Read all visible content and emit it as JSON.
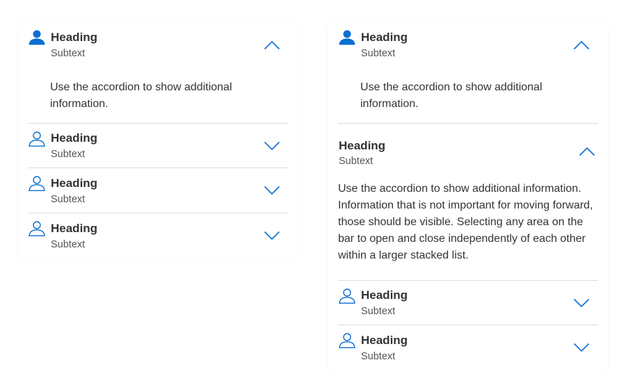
{
  "colors": {
    "accent": "#0a6ed1",
    "text": "#333333",
    "subtext": "#555555",
    "divider": "#dcdcdc"
  },
  "left_panel": {
    "items": [
      {
        "heading": "Heading",
        "subtext": "Subtext",
        "expanded": true,
        "icon": "person-filled-icon",
        "content": "Use the accordion to show additional information."
      },
      {
        "heading": "Heading",
        "subtext": "Subtext",
        "expanded": false,
        "icon": "person-outline-icon"
      },
      {
        "heading": "Heading",
        "subtext": "Subtext",
        "expanded": false,
        "icon": "person-outline-icon"
      },
      {
        "heading": "Heading",
        "subtext": "Subtext",
        "expanded": false,
        "icon": "person-outline-icon"
      }
    ]
  },
  "right_panel": {
    "items": [
      {
        "heading": "Heading",
        "subtext": "Subtext",
        "expanded": true,
        "icon": "person-filled-icon",
        "content": "Use the accordion to show additional information."
      },
      {
        "heading": "Heading",
        "subtext": "Subtext",
        "expanded": true,
        "icon": "",
        "content": "Use the accordion to show additional information. Information that is not important for moving forward, those should be visible. Selecting any area on the bar to open and close independently of each other within a larger stacked list."
      },
      {
        "heading": "Heading",
        "subtext": "Subtext",
        "expanded": false,
        "icon": "person-outline-icon"
      },
      {
        "heading": "Heading",
        "subtext": "Subtext",
        "expanded": false,
        "icon": "person-outline-icon"
      }
    ]
  }
}
